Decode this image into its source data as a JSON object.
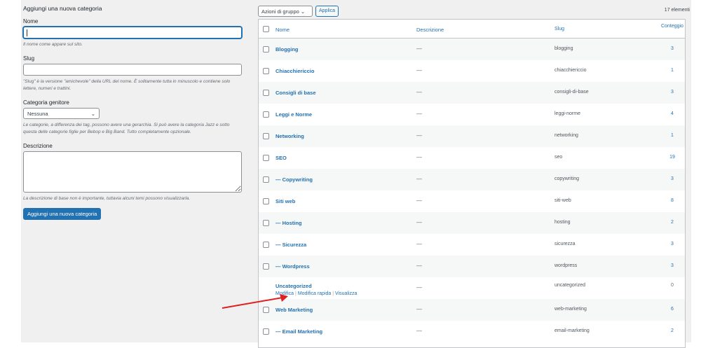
{
  "form": {
    "title": "Aggiungi una nuova categoria",
    "name_label": "Nome",
    "name_value": "",
    "name_help": "Il nome come appare sul sito.",
    "slug_label": "Slug",
    "slug_value": "",
    "slug_help": "\"Slug\" è la versione \"amichevole\" della URL del nome. È solitamente tutta in minuscolo e contiene solo lettere, numeri e trattini.",
    "parent_label": "Categoria genitore",
    "parent_value": "Nessuna",
    "parent_help": "Le categorie, a differenza dei tag, possono avere una gerarchia. Si può avere la categoria Jazz e sotto questa delle categorie figlie per Bebop e Big Band. Tutto completamente opzionale.",
    "desc_label": "Descrizione",
    "desc_value": "",
    "desc_help": "La descrizione di base non è importante, tuttavia alcuni temi possono visualizzarla.",
    "submit": "Aggiungi una nuova categoria"
  },
  "toolbar": {
    "bulk": "Azioni di gruppo",
    "apply": "Applica",
    "count": "17 elementi"
  },
  "table": {
    "headers": {
      "name": "Nome",
      "desc": "Descrizione",
      "slug": "Slug",
      "count": "Conteggio"
    },
    "rows": [
      {
        "name": "Blogging",
        "desc": "—",
        "slug": "blogging",
        "count": "3"
      },
      {
        "name": "Chiacchiericcio",
        "desc": "—",
        "slug": "chiacchiericcio",
        "count": "1"
      },
      {
        "name": "Consigli di base",
        "desc": "—",
        "slug": "consigli-di-base",
        "count": "3"
      },
      {
        "name": "Leggi e Norme",
        "desc": "—",
        "slug": "leggi-norme",
        "count": "4"
      },
      {
        "name": "Networking",
        "desc": "—",
        "slug": "networking",
        "count": "1"
      },
      {
        "name": "SEO",
        "desc": "—",
        "slug": "seo",
        "count": "19"
      },
      {
        "name": "— Copywriting",
        "desc": "—",
        "slug": "copywriting",
        "count": "3"
      },
      {
        "name": "Siti web",
        "desc": "—",
        "slug": "siti-web",
        "count": "8"
      },
      {
        "name": "— Hosting",
        "desc": "—",
        "slug": "hosting",
        "count": "2"
      },
      {
        "name": "— Sicurezza",
        "desc": "—",
        "slug": "sicurezza",
        "count": "3"
      },
      {
        "name": "— Wordpress",
        "desc": "—",
        "slug": "wordpress",
        "count": "3"
      },
      {
        "name": "Uncategorized",
        "desc": "—",
        "slug": "uncategorized",
        "count": "0"
      },
      {
        "name": "Web Marketing",
        "desc": "—",
        "slug": "web-marketing",
        "count": "6"
      },
      {
        "name": "— Email Marketing",
        "desc": "—",
        "slug": "email-marketing",
        "count": "2"
      }
    ],
    "row_actions": {
      "edit": "Modifica",
      "quick_edit": "Modifica rapida",
      "view": "Visualizza"
    }
  },
  "colors": {
    "accent": "#2271b1",
    "arrow": "#e02020"
  }
}
